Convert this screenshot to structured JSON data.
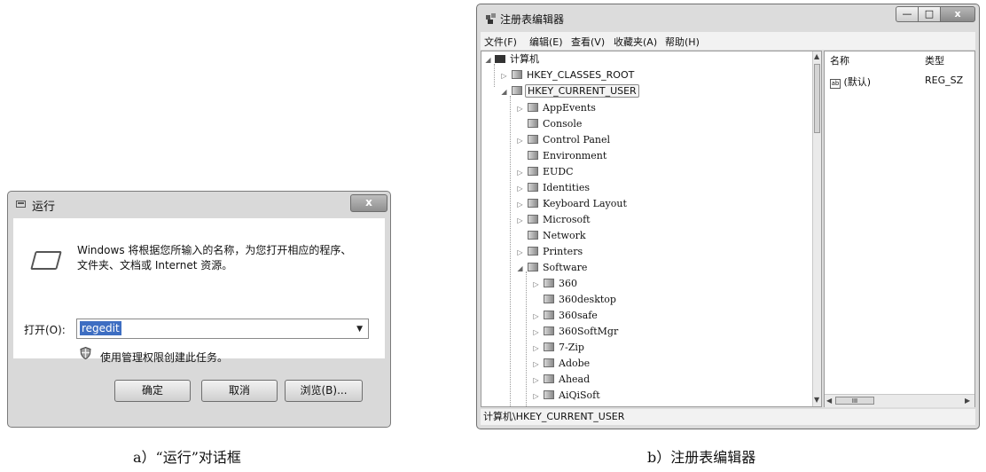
{
  "run_dialog": {
    "title": "运行",
    "description_line1": "Windows 将根据您所输入的名称，为您打开相应的程序、",
    "description_line2": "文件夹、文档或 Internet 资源。",
    "open_label": "打开(O):",
    "open_value": "regedit",
    "admin_note": "使用管理权限创建此任务。",
    "ok_label": "确定",
    "cancel_label": "取消",
    "browse_label": "浏览(B)...",
    "close_glyph": "x"
  },
  "registry_editor": {
    "title": "注册表编辑器",
    "menu": [
      "文件(F)",
      "编辑(E)",
      "查看(V)",
      "收藏夹(A)",
      "帮助(H)"
    ],
    "tree": {
      "root": "计算机",
      "hives": [
        "HKEY_CLASSES_ROOT",
        "HKEY_CURRENT_USER"
      ],
      "current_user_children": [
        "AppEvents",
        "Console",
        "Control Panel",
        "Environment",
        "EUDC",
        "Identities",
        "Keyboard Layout",
        "Microsoft",
        "Network",
        "Printers",
        "Software"
      ],
      "software_children": [
        "360",
        "360desktop",
        "360safe",
        "360SoftMgr",
        "7-Zip",
        "Adobe",
        "Ahead",
        "AiQiSoft"
      ]
    },
    "values_header": {
      "name": "名称",
      "type": "类型"
    },
    "values": [
      {
        "name": "(默认)",
        "type": "REG_SZ"
      }
    ],
    "h_thumb_glyph": "III",
    "status": "计算机\\HKEY_CURRENT_USER"
  },
  "captions": {
    "a": "a）“运行”对话框",
    "b": "b）注册表编辑器"
  }
}
